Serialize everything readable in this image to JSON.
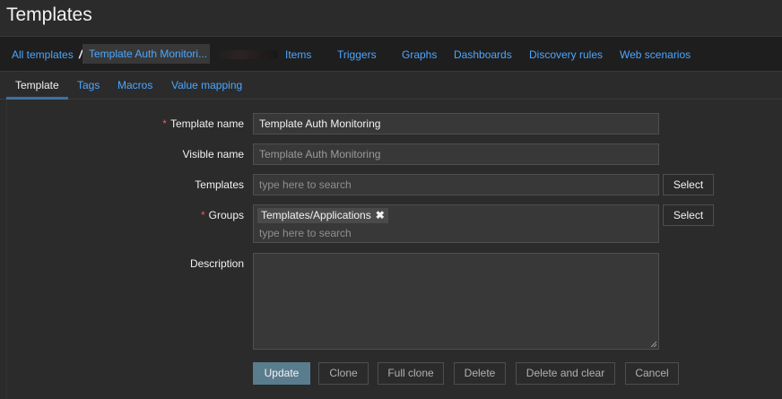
{
  "header": {
    "title": "Templates"
  },
  "breadcrumb": {
    "all_templates": "All templates",
    "separator": "/",
    "current": "Template Auth Monitori..."
  },
  "nav_links": [
    {
      "label": "Items"
    },
    {
      "label": "Triggers"
    },
    {
      "label": "Graphs"
    },
    {
      "label": "Dashboards"
    },
    {
      "label": "Discovery rules"
    },
    {
      "label": "Web scenarios"
    }
  ],
  "tabs": [
    {
      "label": "Template",
      "active": true
    },
    {
      "label": "Tags",
      "active": false
    },
    {
      "label": "Macros",
      "active": false
    },
    {
      "label": "Value mapping",
      "active": false
    }
  ],
  "form": {
    "template_name": {
      "label": "Template name",
      "required_mark": "*",
      "value": "Template Auth Monitoring"
    },
    "visible_name": {
      "label": "Visible name",
      "value": "Template Auth Monitoring"
    },
    "templates": {
      "label": "Templates",
      "placeholder": "type here to search",
      "select_label": "Select"
    },
    "groups": {
      "label": "Groups",
      "required_mark": "*",
      "chip": "Templates/Applications",
      "chip_close": "✖",
      "placeholder": "type here to search",
      "select_label": "Select"
    },
    "description": {
      "label": "Description",
      "value": ""
    }
  },
  "actions": {
    "update": "Update",
    "clone": "Clone",
    "full_clone": "Full clone",
    "delete": "Delete",
    "delete_and_clear": "Delete and clear",
    "cancel": "Cancel"
  },
  "colors": {
    "link": "#4da6ff",
    "required": "#e45959",
    "primary_button": "#5a7d8e",
    "background": "#2b2b2b",
    "breadcrumb_bg": "#1e1e1e"
  }
}
